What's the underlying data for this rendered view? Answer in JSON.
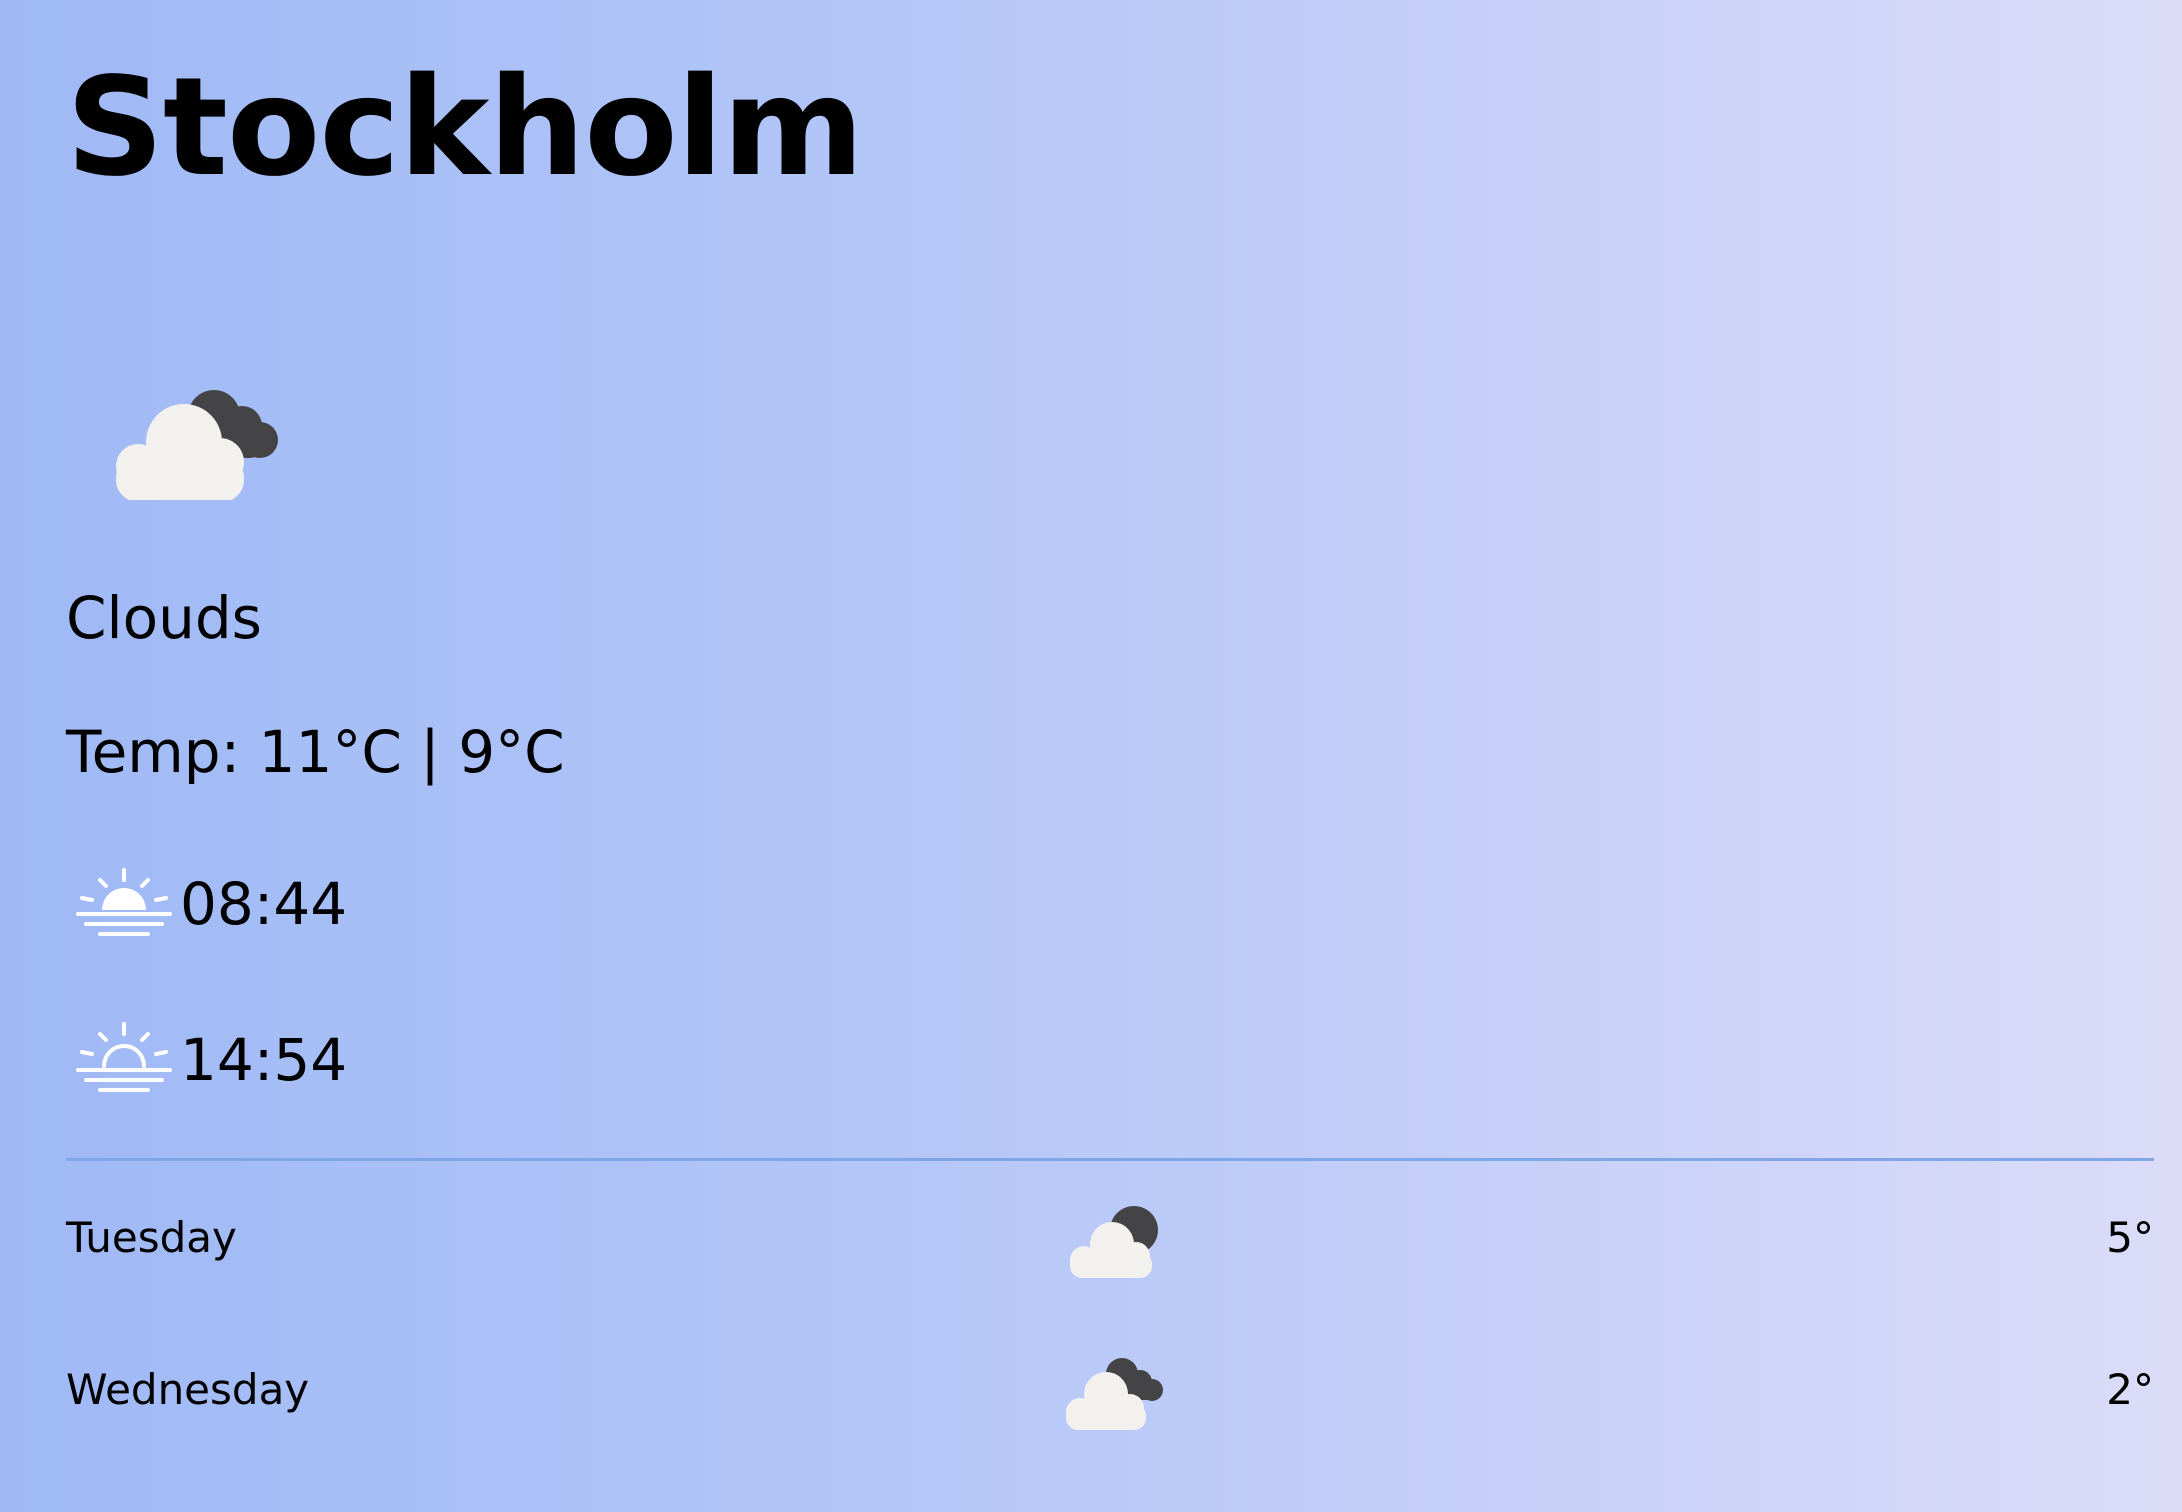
{
  "city": "Stockholm",
  "current": {
    "icon": "clouds-icon",
    "condition": "Clouds",
    "temp_text": "Temp: 11°C | 9°C",
    "sunrise": "08:44",
    "sunset": "14:54"
  },
  "forecast": [
    {
      "day": "Tuesday",
      "icon": "partly-cloudy-night-icon",
      "temp": "5°"
    },
    {
      "day": "Wednesday",
      "icon": "clouds-icon",
      "temp": "2°"
    }
  ],
  "colors": {
    "gradient_start": "#9fb9f5",
    "gradient_end": "#dcdcf8",
    "divider": "#7fa6e6",
    "cloud_light": "#f2f1ee",
    "cloud_dark": "#444446"
  }
}
